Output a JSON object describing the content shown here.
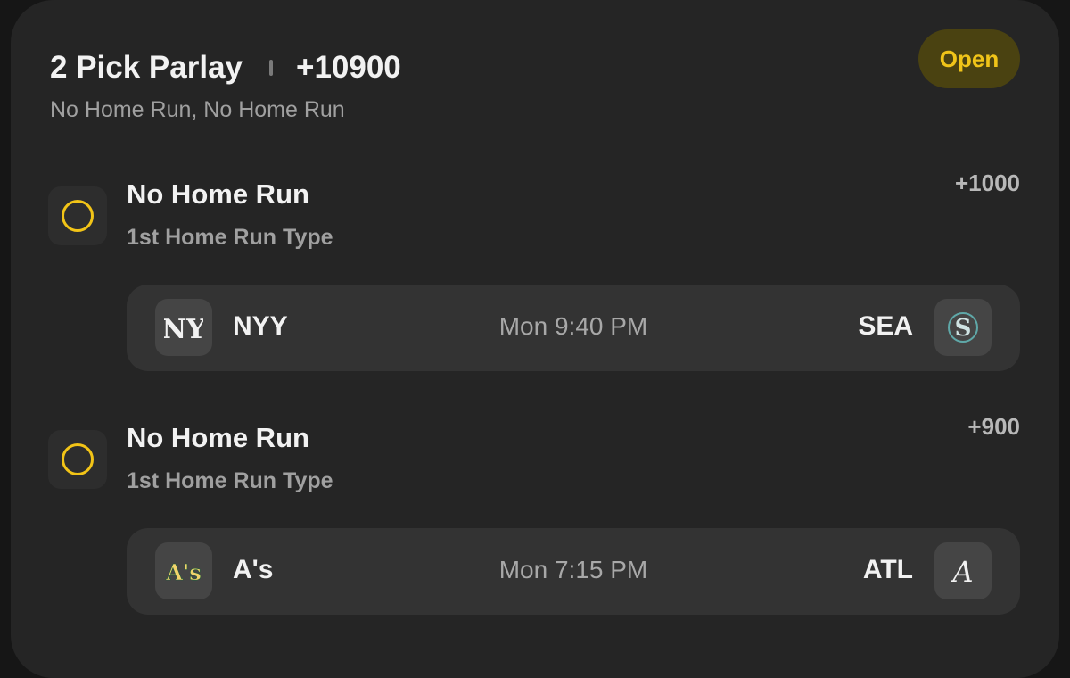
{
  "header": {
    "title": "2 Pick Parlay",
    "odds": "+10900",
    "subtitle": "No Home Run, No Home Run",
    "status": "Open"
  },
  "picks": [
    {
      "title": "No Home Run",
      "type": "1st Home Run Type",
      "odds": "+1000",
      "game": {
        "away_abbr": "NYY",
        "away_logo": "yankees-logo",
        "time": "Mon 9:40 PM",
        "home_abbr": "SEA",
        "home_logo": "mariners-logo"
      }
    },
    {
      "title": "No Home Run",
      "type": "1st Home Run Type",
      "odds": "+900",
      "game": {
        "away_abbr": "A's",
        "away_logo": "athletics-logo",
        "time": "Mon 7:15 PM",
        "home_abbr": "ATL",
        "home_logo": "braves-logo"
      }
    }
  ],
  "colors": {
    "accent": "#f2c417",
    "badge_bg": "#4a4211",
    "card_bg": "#252525",
    "game_bg": "#333333"
  }
}
